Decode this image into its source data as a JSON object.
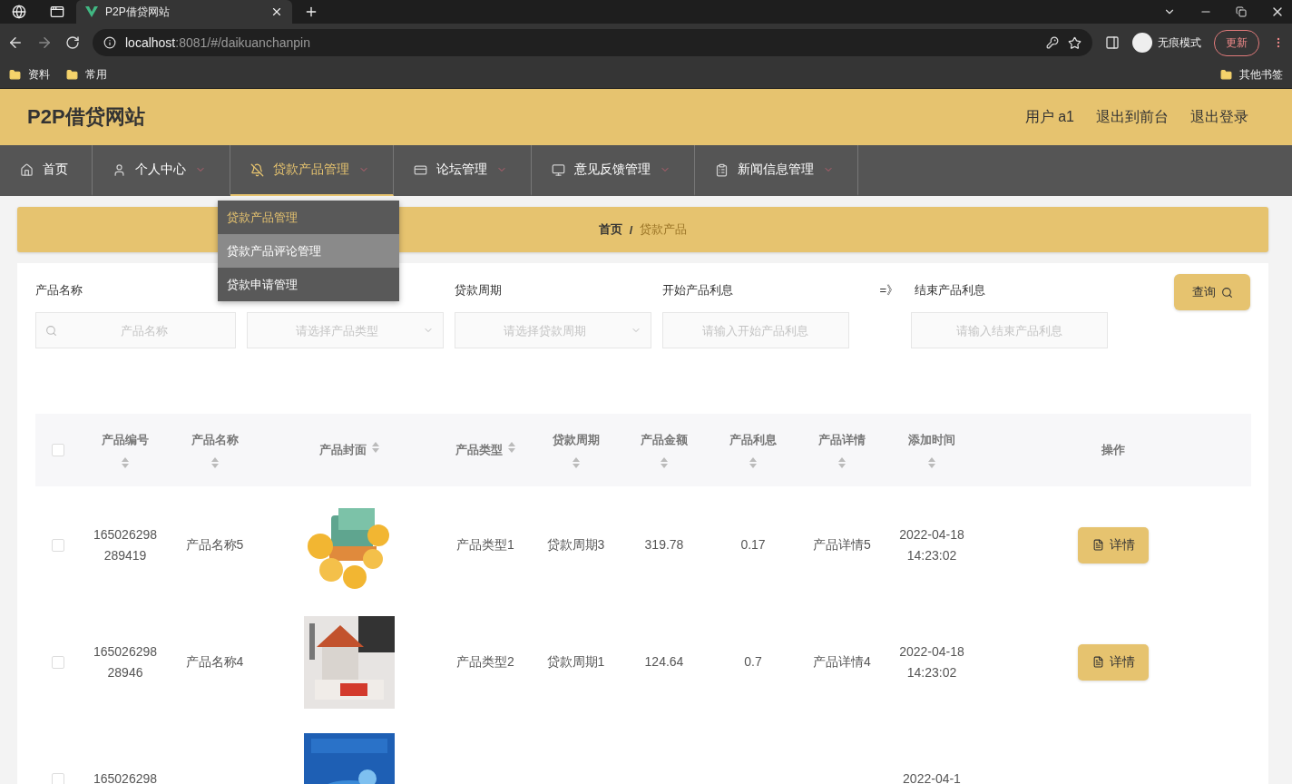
{
  "browser": {
    "tabs": [
      {
        "title": "P2P借贷网站",
        "selected": true
      }
    ],
    "url_host": "localhost",
    "url_rest": ":8081/#/daikuanchanpin",
    "profile_label": "无痕模式",
    "update_button": "更新",
    "bookmarks": [
      "资料",
      "常用"
    ],
    "other_bookmarks": "其他书签"
  },
  "header": {
    "title": "P2P借贷网站",
    "links": [
      "用户 a1",
      "退出到前台",
      "退出登录"
    ]
  },
  "nav": [
    {
      "label": "首页",
      "selected": false,
      "has_menu": false
    },
    {
      "label": "个人中心",
      "selected": false,
      "has_menu": true
    },
    {
      "label": "贷款产品管理",
      "selected": true,
      "has_menu": true
    },
    {
      "label": "论坛管理",
      "selected": false,
      "has_menu": true
    },
    {
      "label": "意见反馈管理",
      "selected": false,
      "has_menu": true
    },
    {
      "label": "新闻信息管理",
      "selected": false,
      "has_menu": true
    }
  ],
  "menu": {
    "items": [
      {
        "label": "贷款产品管理",
        "selected": false
      },
      {
        "label": "贷款产品评论管理",
        "selected": true
      },
      {
        "label": "贷款申请管理",
        "selected": false
      }
    ]
  },
  "breadcrumb": {
    "home": "首页",
    "separator": "/",
    "current": "贷款产品"
  },
  "filters": [
    {
      "kind": "text",
      "label": "产品名称",
      "placeholder": "产品名称",
      "search_icon": true
    },
    {
      "kind": "select",
      "placeholder": "请选择产品类型"
    },
    {
      "kind": "select",
      "label": "贷款周期",
      "placeholder": "请选择贷款周期"
    },
    {
      "kind": "text",
      "label": "开始产品利息",
      "placeholder": "请输入开始产品利息"
    },
    {
      "kind": "text",
      "prefix": "=》",
      "label": "结束产品利息",
      "placeholder": "请输入结束产品利息"
    }
  ],
  "search_button": "查询",
  "table": {
    "columns": [
      {
        "label": "产品编号",
        "sortable": true
      },
      {
        "label": "产品名称",
        "sortable": true
      },
      {
        "label": "产品封面",
        "sortable": true
      },
      {
        "label": "产品类型",
        "sortable": true
      },
      {
        "label": "贷款周期",
        "sortable": true
      },
      {
        "label": "产品金额",
        "sortable": true
      },
      {
        "label": "产品利息",
        "sortable": true
      },
      {
        "label": "产品详情",
        "sortable": true
      },
      {
        "label": "添加时间",
        "sortable": true
      },
      {
        "label": "操作",
        "sortable": false
      }
    ],
    "header_checked": false,
    "rows": [
      {
        "checked": false,
        "cells": [
          "165026298289419",
          "产品名称5",
          {
            "kind": "picture"
          },
          "产品类型1",
          "贷款周期3",
          "319.78",
          "0.17",
          "产品详情5",
          "2022-04-18 14:23:02"
        ],
        "action": "详情"
      },
      {
        "checked": false,
        "cells": [
          "16502629828946",
          "产品名称4",
          {
            "kind": "picture"
          },
          "产品类型2",
          "贷款周期1",
          "124.64",
          "0.7",
          "产品详情4",
          "2022-04-18 14:23:02"
        ],
        "action": "详情"
      },
      {
        "checked": false,
        "cells": [
          "165026298",
          null,
          {
            "kind": "picture"
          },
          null,
          null,
          null,
          null,
          null,
          "2022-04-1"
        ]
      }
    ]
  }
}
